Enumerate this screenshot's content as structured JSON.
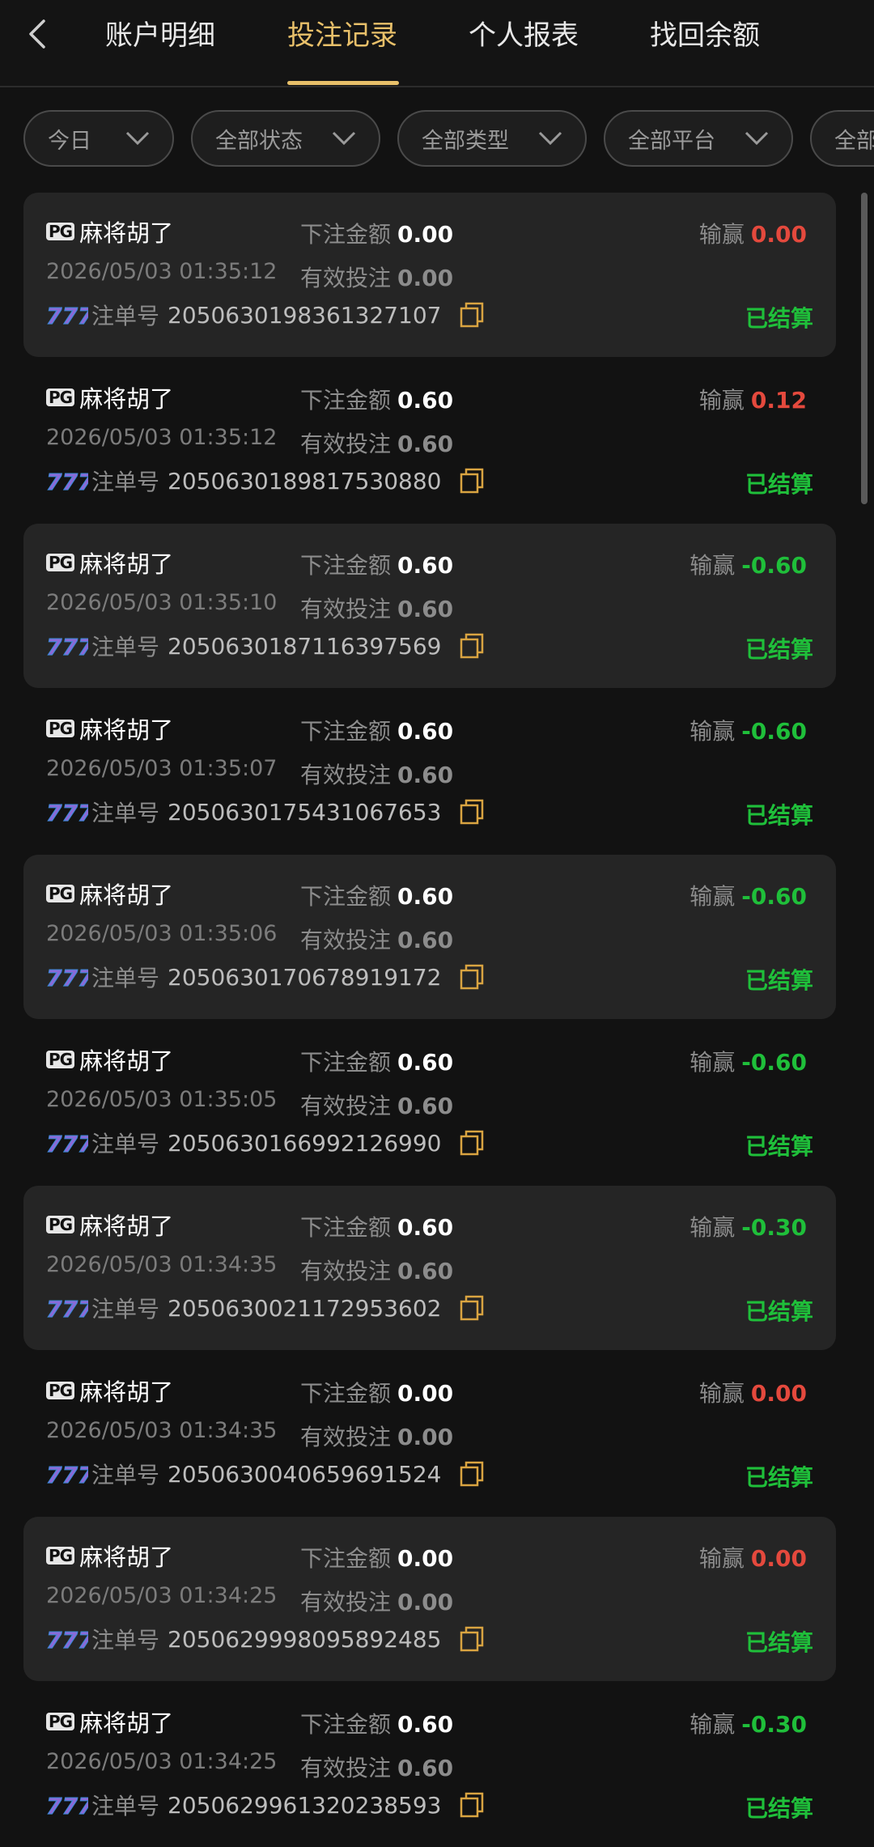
{
  "header": {
    "tabs": [
      {
        "label": "账户明细"
      },
      {
        "label": "投注记录"
      },
      {
        "label": "个人报表"
      },
      {
        "label": "找回余额"
      }
    ],
    "active_tab": 1
  },
  "filters": [
    {
      "label": "今日"
    },
    {
      "label": "全部状态"
    },
    {
      "label": "全部类型"
    },
    {
      "label": "全部平台"
    },
    {
      "label": "全部"
    }
  ],
  "labels": {
    "bet_amount": "下注金额",
    "valid_bet": "有效投注",
    "win_loss": "输赢",
    "order_no": "注单号",
    "provider_logo": "PG"
  },
  "colors": {
    "accent": "#e8c06a",
    "win_red": "#e4493d",
    "loss_green": "#1fbf3a",
    "status_settled": "#1fbf3a"
  },
  "records": [
    {
      "game": "麻将胡了",
      "time": "2026/05/03 01:35:12",
      "order_no": "2050630198361327107",
      "bet": "0.00",
      "valid": "0.00",
      "win": "0.00",
      "win_type": "red",
      "status": "已结算"
    },
    {
      "game": "麻将胡了",
      "time": "2026/05/03 01:35:12",
      "order_no": "2050630189817530880",
      "bet": "0.60",
      "valid": "0.60",
      "win": "0.12",
      "win_type": "red",
      "status": "已结算"
    },
    {
      "game": "麻将胡了",
      "time": "2026/05/03 01:35:10",
      "order_no": "2050630187116397569",
      "bet": "0.60",
      "valid": "0.60",
      "win": "-0.60",
      "win_type": "green",
      "status": "已结算"
    },
    {
      "game": "麻将胡了",
      "time": "2026/05/03 01:35:07",
      "order_no": "2050630175431067653",
      "bet": "0.60",
      "valid": "0.60",
      "win": "-0.60",
      "win_type": "green",
      "status": "已结算"
    },
    {
      "game": "麻将胡了",
      "time": "2026/05/03 01:35:06",
      "order_no": "2050630170678919172",
      "bet": "0.60",
      "valid": "0.60",
      "win": "-0.60",
      "win_type": "green",
      "status": "已结算"
    },
    {
      "game": "麻将胡了",
      "time": "2026/05/03 01:35:05",
      "order_no": "2050630166992126990",
      "bet": "0.60",
      "valid": "0.60",
      "win": "-0.60",
      "win_type": "green",
      "status": "已结算"
    },
    {
      "game": "麻将胡了",
      "time": "2026/05/03 01:34:35",
      "order_no": "2050630021172953602",
      "bet": "0.60",
      "valid": "0.60",
      "win": "-0.30",
      "win_type": "green",
      "status": "已结算"
    },
    {
      "game": "麻将胡了",
      "time": "2026/05/03 01:34:35",
      "order_no": "2050630040659691524",
      "bet": "0.00",
      "valid": "0.00",
      "win": "0.00",
      "win_type": "red",
      "status": "已结算"
    },
    {
      "game": "麻将胡了",
      "time": "2026/05/03 01:34:25",
      "order_no": "2050629998095892485",
      "bet": "0.00",
      "valid": "0.00",
      "win": "0.00",
      "win_type": "red",
      "status": "已结算"
    },
    {
      "game": "麻将胡了",
      "time": "2026/05/03 01:34:25",
      "order_no": "2050629961320238593",
      "bet": "0.60",
      "valid": "0.60",
      "win": "-0.30",
      "win_type": "green",
      "status": "已结算"
    }
  ]
}
